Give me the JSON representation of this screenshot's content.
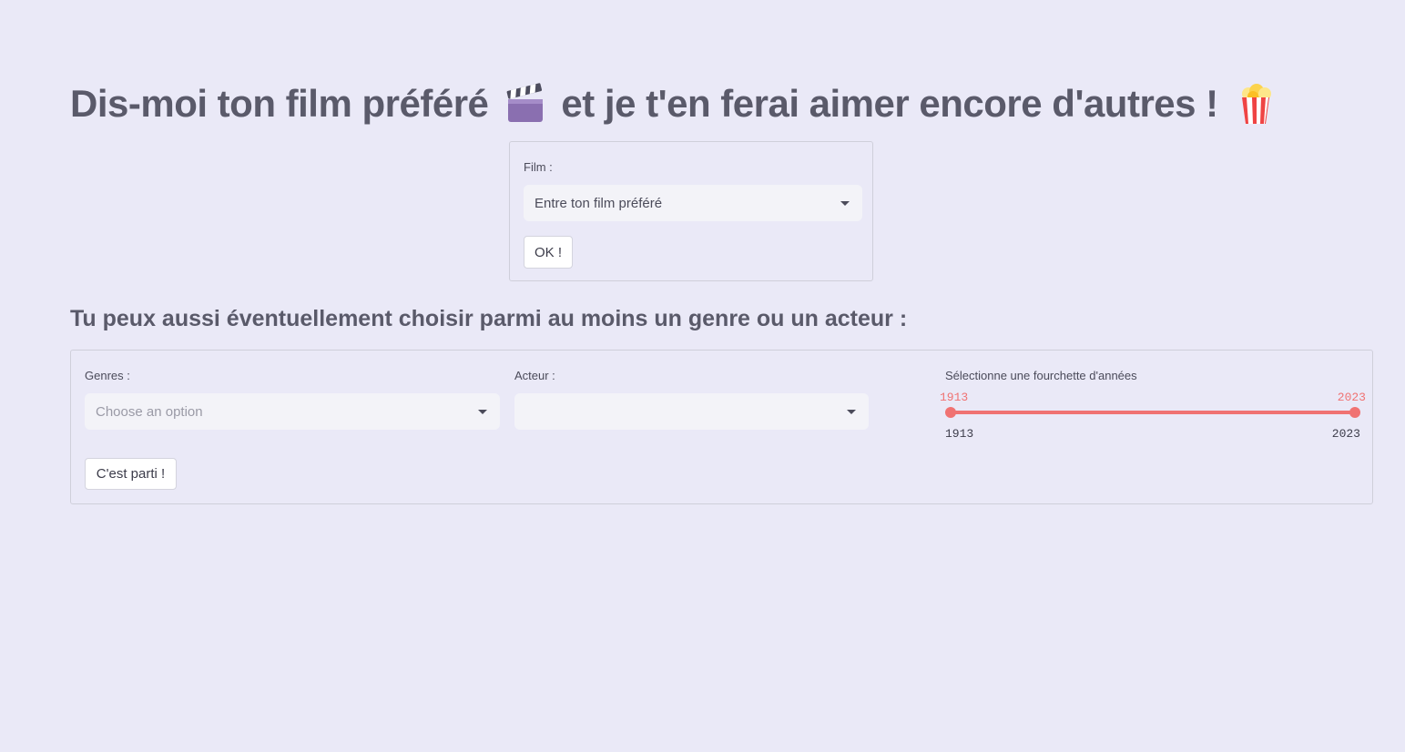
{
  "title": {
    "part1": "Dis-moi ton film préféré",
    "icon1": "clapperboard-icon",
    "part2": "et je t'en ferai aimer encore d'autres !",
    "icon2": "popcorn-icon"
  },
  "film_form": {
    "label": "Film :",
    "select_value": "Entre ton film préféré",
    "submit_label": "OK !"
  },
  "subtitle": "Tu peux aussi éventuellement choisir parmi au moins un genre ou un acteur :",
  "filter_form": {
    "genres": {
      "label": "Genres :",
      "placeholder": "Choose an option"
    },
    "actor": {
      "label": "Acteur :",
      "value": ""
    },
    "year_slider": {
      "label": "Sélectionne une fourchette d'années",
      "min": 1913,
      "max": 2023,
      "selected_low": 1913,
      "selected_high": 2023,
      "low_label": "1913",
      "high_label": "2023",
      "min_label": "1913",
      "max_label": "2023"
    },
    "submit_label": "C'est parti !"
  },
  "colors": {
    "background": "#eae9f7",
    "accent": "#f07272",
    "text": "#5a5a6a"
  }
}
